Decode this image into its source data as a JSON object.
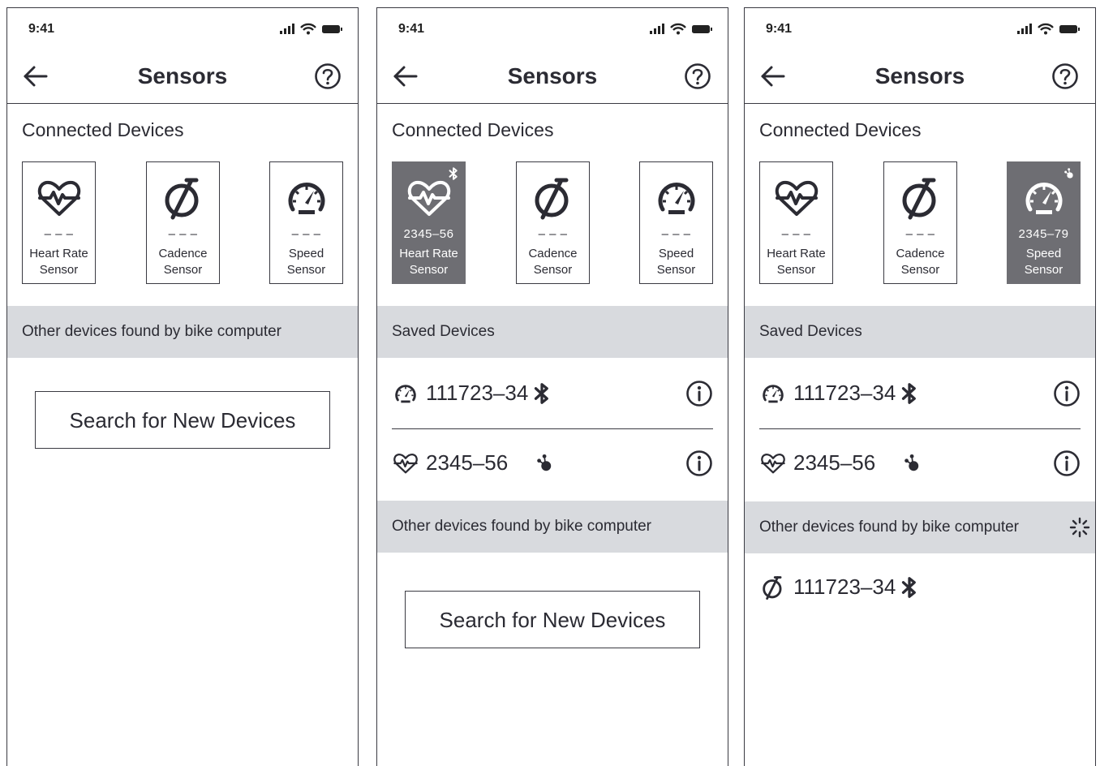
{
  "screens": [
    {
      "status_time": "9:41",
      "title": "Sensors",
      "connected_title": "Connected Devices",
      "cards": [
        {
          "icon": "heart-rate-icon",
          "id": "– – –",
          "label1": "Heart Rate",
          "label2": "Sensor",
          "active": false
        },
        {
          "icon": "cadence-icon",
          "id": "– – –",
          "label1": "Cadence",
          "label2": "Sensor",
          "active": false
        },
        {
          "icon": "speedometer-icon",
          "id": "– – –",
          "label1": "Speed",
          "label2": "Sensor",
          "active": false
        }
      ],
      "other_band": "Other devices found by bike computer",
      "search_label": "Search for New Devices"
    },
    {
      "status_time": "9:41",
      "title": "Sensors",
      "connected_title": "Connected Devices",
      "cards": [
        {
          "icon": "heart-rate-icon",
          "id": "2345–56",
          "label1": "Heart Rate",
          "label2": "Sensor",
          "active": true,
          "badge": "bluetooth-icon"
        },
        {
          "icon": "cadence-icon",
          "id": "– – –",
          "label1": "Cadence",
          "label2": "Sensor",
          "active": false
        },
        {
          "icon": "speedometer-icon",
          "id": "– – –",
          "label1": "Speed",
          "label2": "Sensor",
          "active": false
        }
      ],
      "saved_band": "Saved Devices",
      "saved": [
        {
          "icon": "speedometer-icon",
          "id": "111723–34",
          "conn": "bluetooth-icon"
        },
        {
          "icon": "heart-rate-icon",
          "id": "2345–56",
          "conn": "ant-plus-icon"
        }
      ],
      "other_band": "Other devices found by bike computer",
      "search_label": "Search for New Devices"
    },
    {
      "status_time": "9:41",
      "title": "Sensors",
      "connected_title": "Connected Devices",
      "cards": [
        {
          "icon": "heart-rate-icon",
          "id": "– – –",
          "label1": "Heart Rate",
          "label2": "Sensor",
          "active": false
        },
        {
          "icon": "cadence-icon",
          "id": "– – –",
          "label1": "Cadence",
          "label2": "Sensor",
          "active": false
        },
        {
          "icon": "speedometer-icon",
          "id": "2345–79",
          "label1": "Speed",
          "label2": "Sensor",
          "active": true,
          "badge": "ant-plus-icon"
        }
      ],
      "saved_band": "Saved Devices",
      "saved": [
        {
          "icon": "speedometer-icon",
          "id": "111723–34",
          "conn": "bluetooth-icon"
        },
        {
          "icon": "heart-rate-icon",
          "id": "2345–56",
          "conn": "ant-plus-icon"
        }
      ],
      "other_band": "Other devices found by bike computer",
      "other_found": [
        {
          "icon": "cadence-icon",
          "id": "111723–34",
          "conn": "bluetooth-icon"
        }
      ],
      "searching_icon": "loading-spinner-icon"
    }
  ]
}
